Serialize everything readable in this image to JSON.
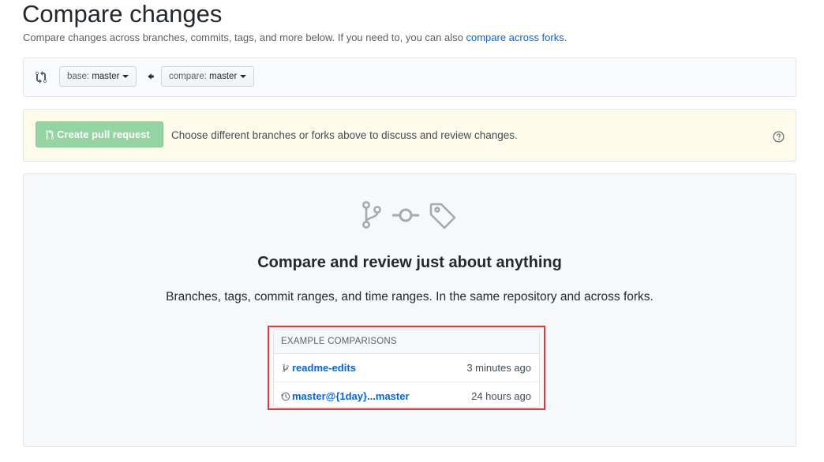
{
  "page": {
    "title": "Compare changes",
    "subtitle_text": "Compare changes across branches, commits, tags, and more below. If you need to, you can also ",
    "subtitle_link": "compare across forks",
    "subtitle_end": "."
  },
  "range": {
    "icon": "git-compare-icon",
    "base_prefix": "base: ",
    "base_branch": "master",
    "compare_prefix": "compare: ",
    "compare_branch": "master",
    "arrow_icon": "arrow-left-icon"
  },
  "flash": {
    "button_label": "Create pull request",
    "button_icon": "git-pull-request-icon",
    "message": "Choose different branches or forks above to discuss and review changes.",
    "help_icon": "question-icon",
    "button_color": "#94d3a2",
    "background_color": "#fffbea"
  },
  "blankslate": {
    "icons": [
      "git-branch-icon",
      "git-commit-icon",
      "tag-icon"
    ],
    "title": "Compare and review just about anything",
    "description": "Branches, tags, commit ranges, and time ranges. In the same repository and across forks."
  },
  "examples": {
    "header": "EXAMPLE COMPARISONS",
    "items": [
      {
        "icon": "git-branch-icon",
        "label": "readme-edits",
        "time": "3 minutes ago"
      },
      {
        "icon": "history-icon",
        "label": "master@{1day}...master",
        "time": "24 hours ago"
      }
    ],
    "highlight_color": "#e5383b",
    "link_color": "#0366d6"
  }
}
